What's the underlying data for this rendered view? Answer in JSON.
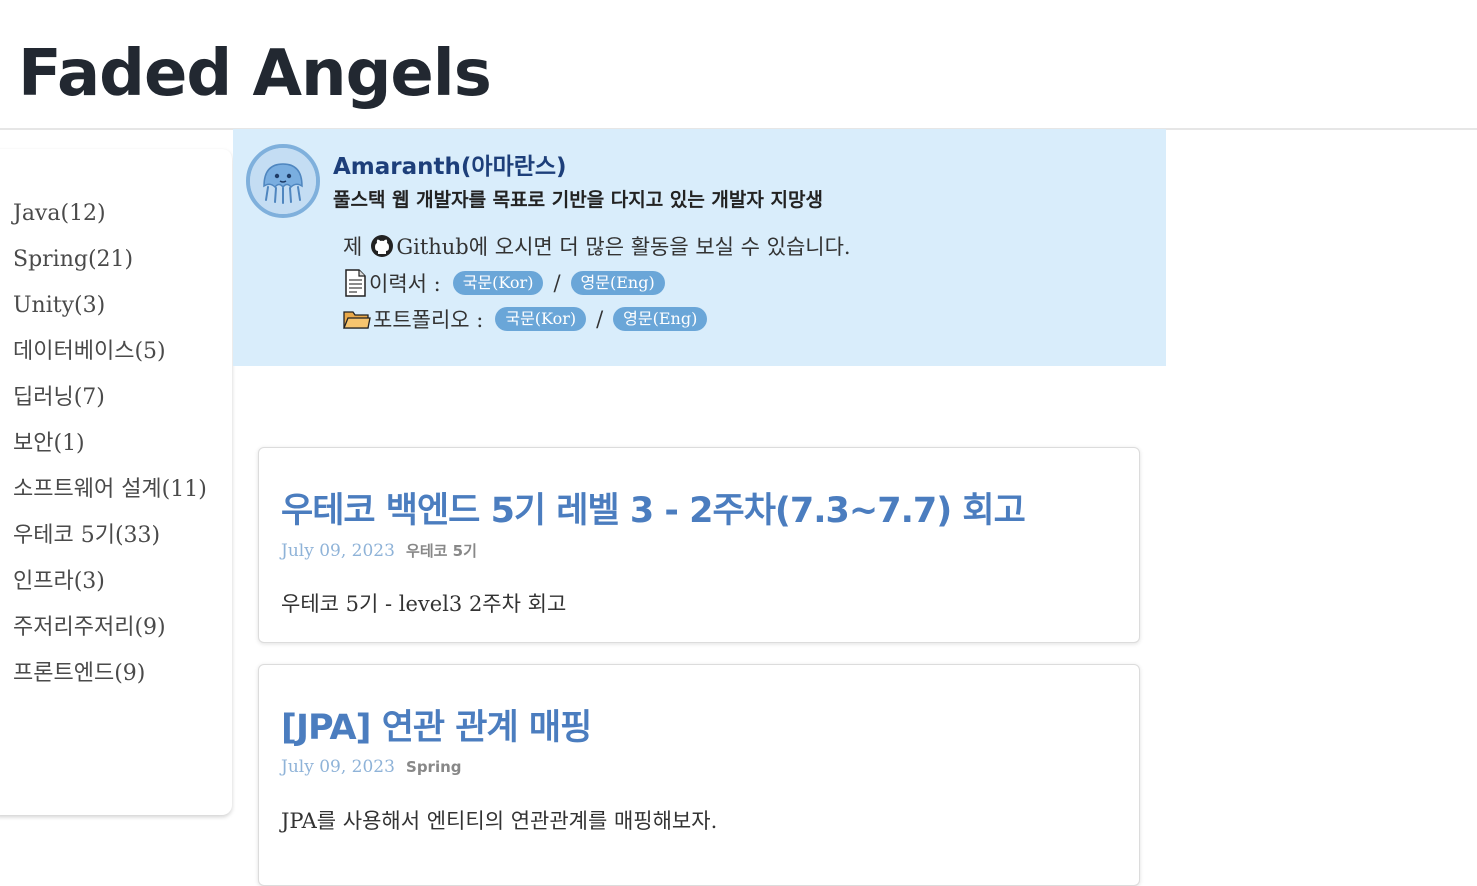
{
  "site": {
    "title": "Faded Angels"
  },
  "sidebar": {
    "categories": [
      "Java(12)",
      "Spring(21)",
      "Unity(3)",
      "데이터베이스(5)",
      "딥러닝(7)",
      "보안(1)",
      "소프트웨어 설계(11)",
      "우테코 5기(33)",
      "인프라(3)",
      "주저리주저리(9)",
      "프론트엔드(9)"
    ]
  },
  "profile": {
    "name": "Amaranth(아마란스)",
    "bio": "풀스택 웹 개발자를 목표로 기반을 다지고 있는 개발자 지망생",
    "github_prefix": "제",
    "github_text": "Github에 오시면 더 많은 활동을 보실 수 있습니다.",
    "resume_label": "이력서 :",
    "resume_kor": "국문(Kor)",
    "resume_eng": "영문(Eng)",
    "portfolio_label": "포트폴리오 :",
    "portfolio_kor": "국문(Kor)",
    "portfolio_eng": "영문(Eng)",
    "separator": "/"
  },
  "posts": [
    {
      "title": "우테코 백엔드 5기 레벨 3 - 2주차(7.3~7.7) 회고",
      "date": "July 09, 2023",
      "category": "우테코 5기",
      "description": "우테코 5기 - level3 2주차 회고"
    },
    {
      "title": "[JPA] 연관 관계 매핑",
      "date": "July 09, 2023",
      "category": "Spring",
      "description": "JPA를 사용해서 엔티티의 연관관계를 매핑해보자."
    }
  ],
  "colors": {
    "profile_bg": "#d9edfb",
    "pill_bg": "#6aa6d8",
    "post_title": "#4b7dbf",
    "name": "#1d3f7a"
  }
}
